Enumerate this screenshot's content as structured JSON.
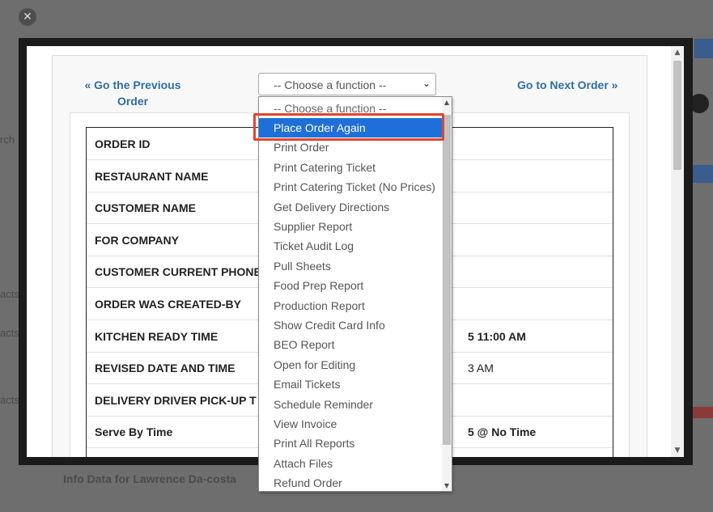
{
  "background": {
    "footer_text": "Info Data for Lawrence Da-costa",
    "side_fragments": [
      "rch",
      "acts",
      "acts",
      "acts"
    ]
  },
  "modal": {
    "close_icon": "✕",
    "nav": {
      "prev_label": "« Go the Previous Order",
      "next_label": "Go to Next Order »"
    },
    "function_select": {
      "selected": "-- Choose a function --",
      "options": [
        "-- Choose a function --",
        "Place Order Again",
        "Print Order",
        "Print Catering Ticket",
        "Print Catering Ticket (No Prices)",
        "Get Delivery Directions",
        "Supplier Report",
        "Ticket Audit Log",
        "Pull Sheets",
        "Food Prep Report",
        "Production Report",
        "Show Credit Card Info",
        "BEO Report",
        "Open for Editing",
        "Email Tickets",
        "Schedule Reminder",
        "View Invoice",
        "Print All Reports",
        "Attach Files",
        "Refund Order"
      ],
      "highlighted": "Place Order Again"
    },
    "order_table": [
      {
        "label": "ORDER ID",
        "value": ""
      },
      {
        "label": "RESTAURANT NAME",
        "value": ""
      },
      {
        "label": "CUSTOMER NAME",
        "value": ""
      },
      {
        "label": "FOR COMPANY",
        "value": ""
      },
      {
        "label": "CUSTOMER CURRENT PHONE",
        "value": ""
      },
      {
        "label": "ORDER WAS CREATED-BY",
        "value": ""
      },
      {
        "label": "KITCHEN READY TIME",
        "value": "5 11:00 AM"
      },
      {
        "label": "REVISED DATE AND TIME",
        "value": "3 AM"
      },
      {
        "label": "DELIVERY DRIVER PICK-UP T",
        "value": ""
      },
      {
        "label": "Serve By Time",
        "value": "5 @ No Time"
      }
    ]
  },
  "colors": {
    "link": "#2e6da4",
    "selected_option": "#1e6fd9",
    "highlight_border": "#e0452e"
  }
}
